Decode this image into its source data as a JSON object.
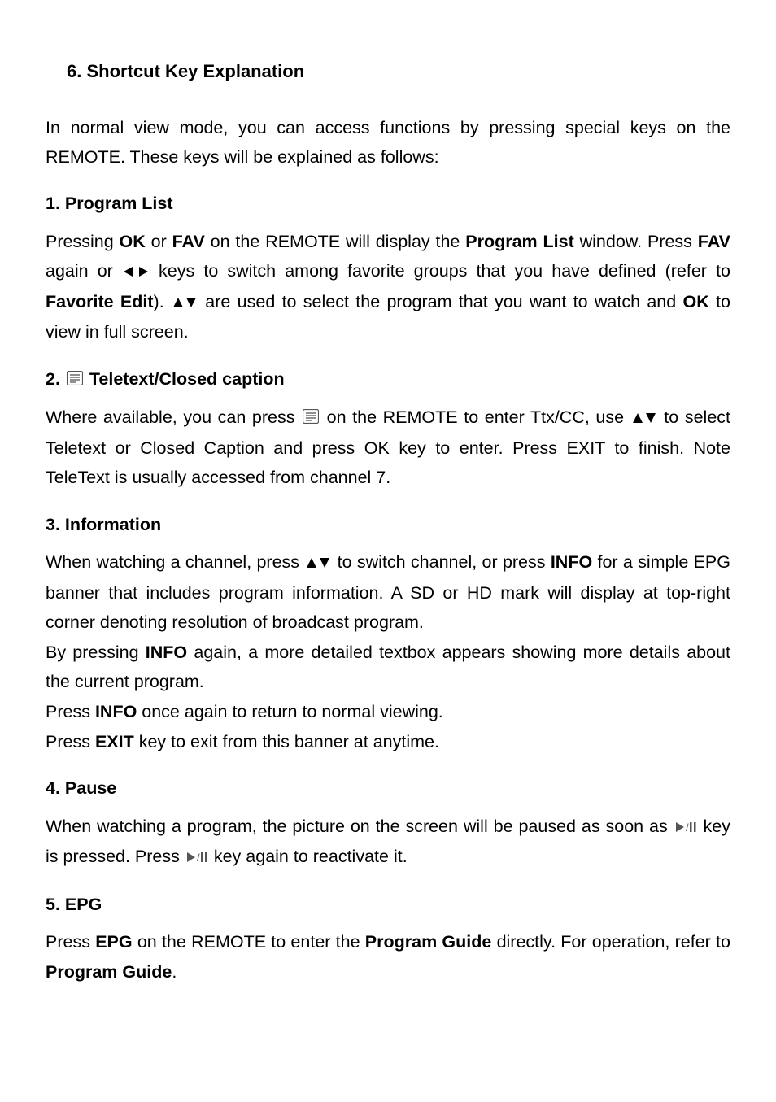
{
  "heading": "6. Shortcut Key Explanation",
  "intro": "In normal view mode, you can access functions by pressing special keys on the REMOTE. These keys will be explained as follows:",
  "s1": {
    "title": "1. Program List",
    "t1": "Pressing ",
    "ok": "OK",
    "t2": " or ",
    "fav": "FAV",
    "t3": " on the REMOTE will display the ",
    "pl": "Program List",
    "t4": " window. Press ",
    "fav2": "FAV",
    "t5": " again or ",
    "t6": " keys to switch among favorite groups that you have defined (refer to ",
    "fe": "Favorite Edit",
    "t7": "). ",
    "t8": " are used to select the program that you want to watch and ",
    "ok2": "OK",
    "t9": " to view in full screen."
  },
  "s2": {
    "title_num": "2.  ",
    "title_text": " Teletext/Closed caption",
    "t1": "Where available, you can press ",
    "t2": " on the REMOTE to enter Ttx/CC, use ",
    "t3": " to select Teletext or Closed Caption and press OK key to enter. Press EXIT to finish. Note TeleText is usually accessed from channel 7."
  },
  "s3": {
    "title": "3. Information",
    "p1a": "When watching a channel, press ",
    "p1b": " to switch channel, or press ",
    "info": "INFO",
    "p1c": " for a simple EPG banner that includes program information. A SD or HD mark will display at top-right corner denoting resolution of broadcast program.",
    "p2a": "By pressing ",
    "p2b": " again, a more detailed textbox appears showing more details about the current program.",
    "p3a": "Press ",
    "p3b": " once again to return to normal viewing.",
    "p4a": "Press ",
    "exit": "EXIT",
    "p4b": " key to exit from this banner at anytime."
  },
  "s4": {
    "title": "4. Pause",
    "t1": "When watching a program, the picture on the screen will be paused as soon as ",
    "t2": " key is pressed. Press ",
    "t3": " key again to reactivate it."
  },
  "s5": {
    "title": "5. EPG",
    "t1": "Press ",
    "epg": "EPG",
    "t2": " on the REMOTE to enter the ",
    "pg": "Program Guide",
    "t3": " directly. For operation, refer to ",
    "pg2": "Program Guide",
    "t4": "."
  }
}
